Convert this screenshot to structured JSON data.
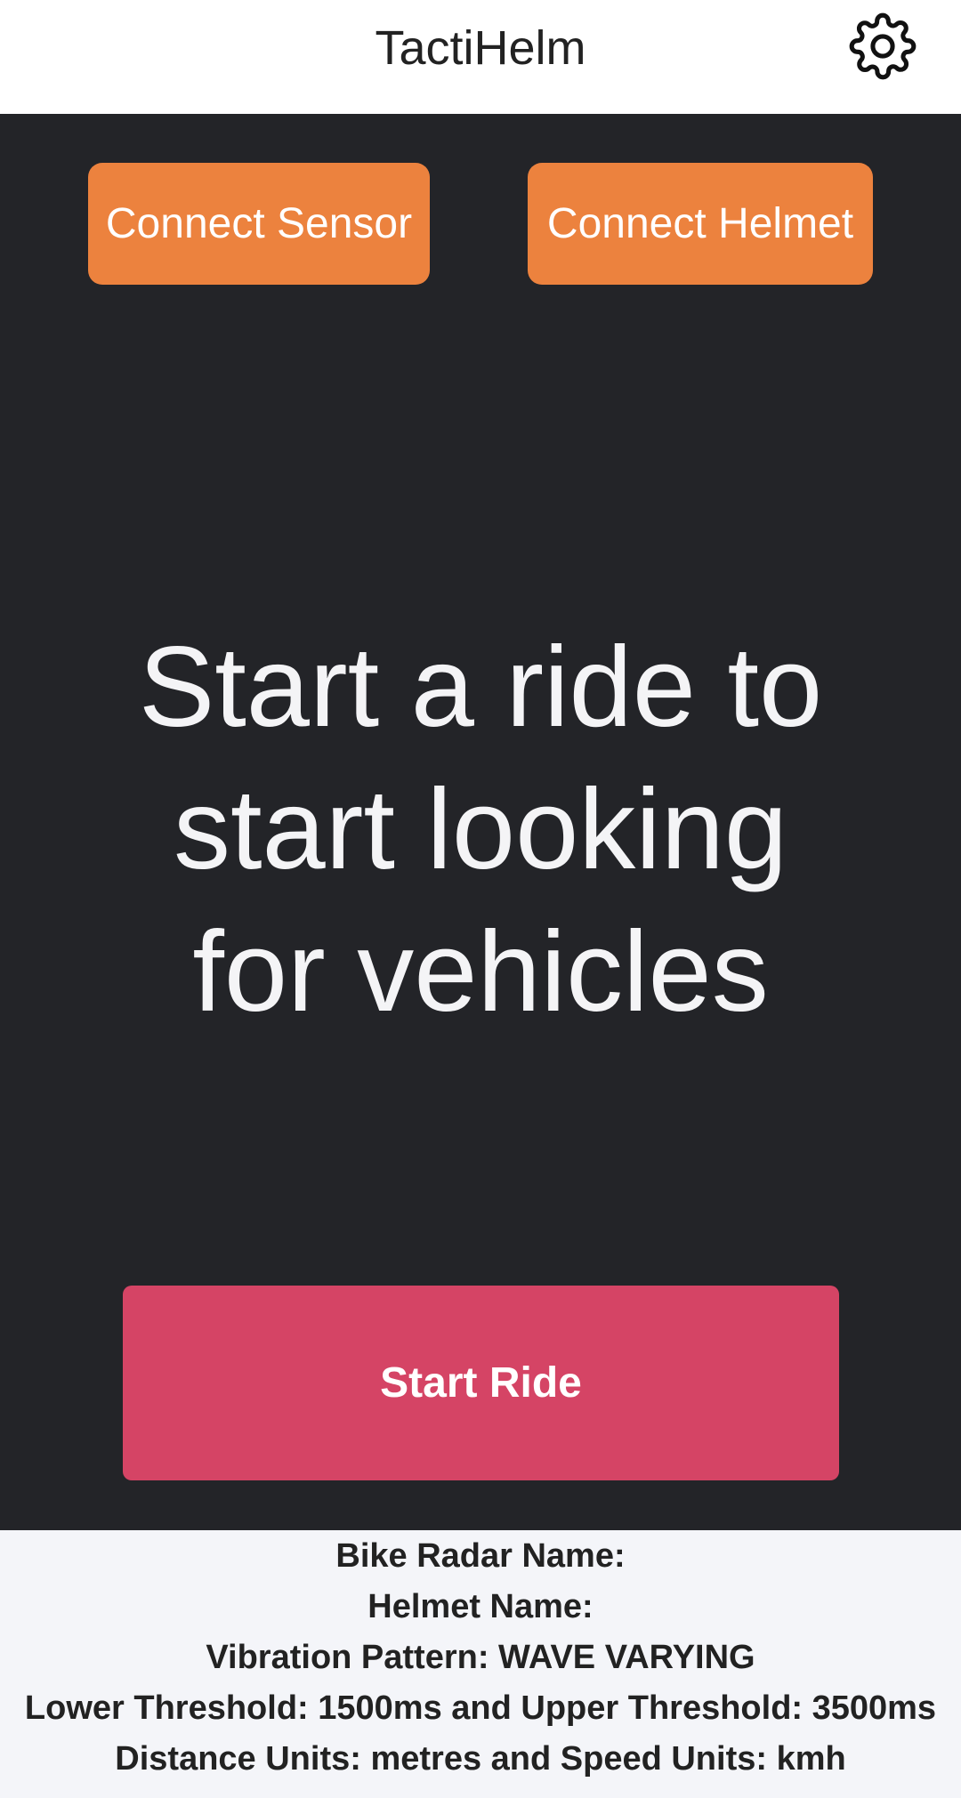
{
  "header": {
    "title": "TactiHelm",
    "settings_icon": "gear-icon"
  },
  "main": {
    "connect_sensor_label": "Connect Sensor",
    "connect_helmet_label": "Connect Helmet",
    "hero_line1": "Start a ride to",
    "hero_line2": "start looking",
    "hero_line3": "for vehicles",
    "start_ride_label": "Start Ride"
  },
  "info": {
    "bike_radar": "Bike Radar Name:",
    "helmet": "Helmet Name:",
    "vibration": "Vibration Pattern: WAVE VARYING",
    "thresholds": "Lower Threshold: 1500ms and Upper Threshold: 3500ms",
    "units": "Distance Units: metres and Speed Units: kmh"
  },
  "colors": {
    "connect_button": "#ec823e",
    "start_ride_button": "#d54465",
    "main_background": "#232428",
    "footer_background": "#f4f5f9"
  }
}
